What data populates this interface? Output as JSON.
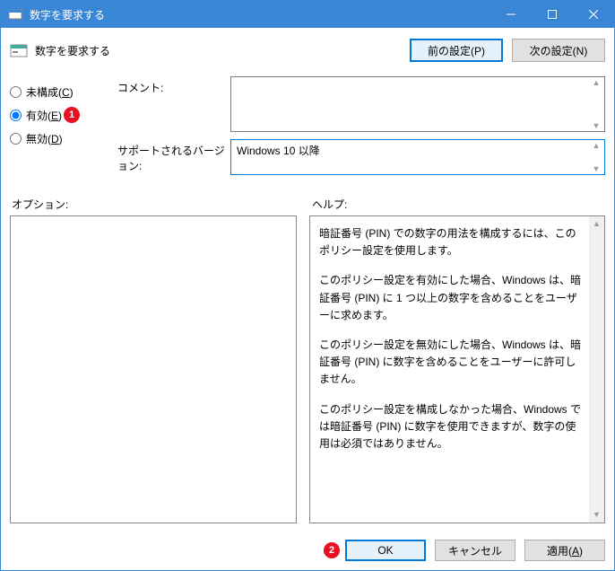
{
  "window": {
    "title": "数字を要求する"
  },
  "header": {
    "title": "数字を要求する",
    "prev_setting": "前の設定(P)",
    "next_setting": "次の設定(N)"
  },
  "radios": {
    "not_configured": "未構成(C)",
    "enabled": "有効(E)",
    "disabled": "無効(D)",
    "selected": "enabled"
  },
  "fields": {
    "comment_label": "コメント:",
    "comment_value": "",
    "support_label": "サポートされるバージョン:",
    "support_value": "Windows 10 以降"
  },
  "sections": {
    "options": "オプション:",
    "help": "ヘルプ:"
  },
  "help_text": {
    "p1": "暗証番号 (PIN) での数字の用法を構成するには、このポリシー設定を使用します。",
    "p2": "このポリシー設定を有効にした場合、Windows は、暗証番号 (PIN) に 1 つ以上の数字を含めることをユーザーに求めます。",
    "p3": "このポリシー設定を無効にした場合、Windows は、暗証番号 (PIN) に数字を含めることをユーザーに許可しません。",
    "p4": "このポリシー設定を構成しなかった場合、Windows では暗証番号 (PIN) に数字を使用できますが、数字の使用は必須ではありません。"
  },
  "buttons": {
    "ok": "OK",
    "cancel": "キャンセル",
    "apply": "適用(A)"
  },
  "callouts": {
    "c1": "1",
    "c2": "2"
  }
}
